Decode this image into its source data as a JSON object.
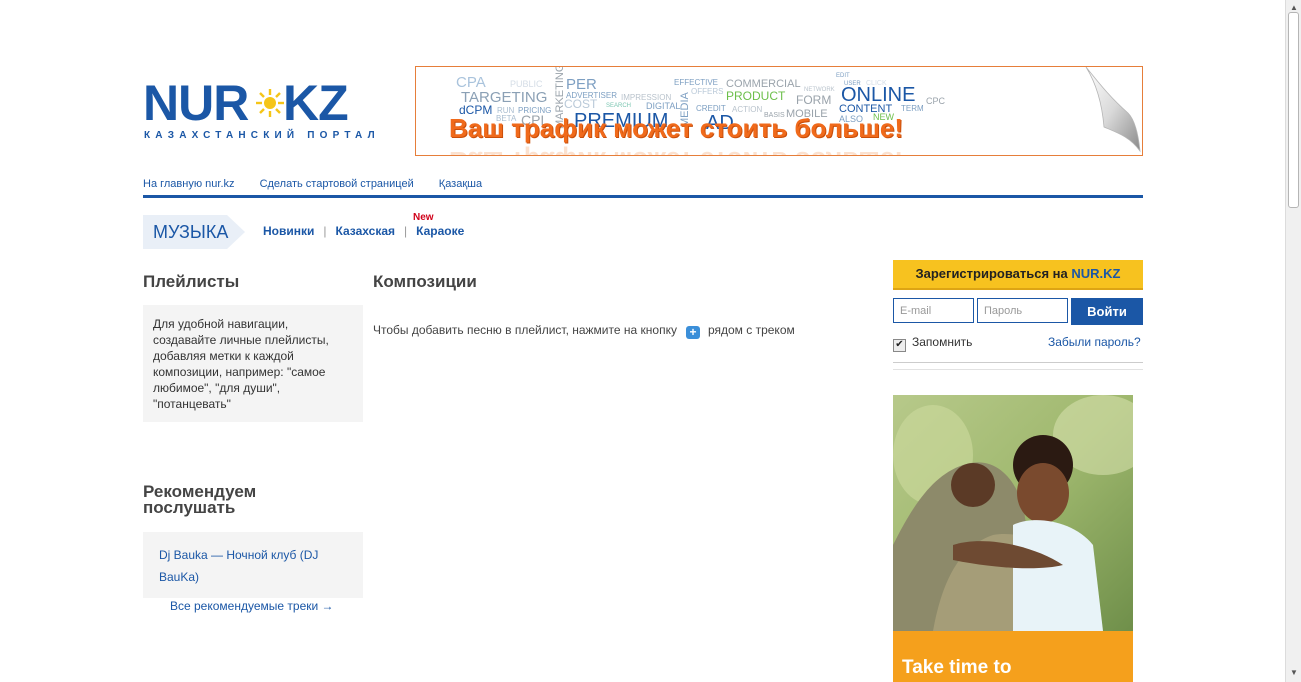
{
  "logo": {
    "word1": "NUR",
    "word2": "KZ",
    "tagline": "КАЗАХСТАНСКИЙ ПОРТАЛ"
  },
  "banner": {
    "headline": "Ваш трафик может стоить больше!",
    "cloud_words": [
      "CPA",
      "PUBLIC",
      "PER",
      "TARGETING",
      "ADVERTISER",
      "dCPM",
      "COST",
      "PRICING",
      "IMPRESSION",
      "PREMIUM",
      "DIGITAL",
      "MEDIA",
      "CREDIT",
      "EFFECTIVE",
      "OFFERS",
      "COMMERCIAL",
      "PRODUCT",
      "FORM",
      "MOBILE",
      "ONLINE",
      "CONTENT",
      "CPC",
      "TERM",
      "NEW",
      "ALSO",
      "BASIS",
      "ACTION",
      "USER",
      "CLICK",
      "EDIT",
      "NETWORK",
      "MARKETING",
      "RUN",
      "BETA",
      "CPL",
      "AD"
    ],
    "colors": {
      "headline": "#f06a1b",
      "border": "#e67e3a"
    }
  },
  "topnav": {
    "items": [
      "На главную nur.kz",
      "Сделать стартовой страницей",
      "Қазақша"
    ]
  },
  "section": {
    "title": "МУЗЫКА"
  },
  "subnav": {
    "items": [
      "Новинки",
      "Казахская",
      "Караоке"
    ],
    "new_badge": "New"
  },
  "playlists": {
    "heading": "Плейлисты",
    "info": "Для удобной навигации, создавайте личные плейлисты, добавляя метки к каждой композиции, например: \"самое любимое\", \"для души\", \"потанцевать\""
  },
  "recommend": {
    "heading": "Рекомендуем послушать",
    "track": "Dj Bauka — Ночной клуб (DJ BauKa)",
    "all_link": "Все рекомендуемые треки →"
  },
  "compositions": {
    "heading": "Композиции",
    "hint_before": "Чтобы добавить песню в плейлист, нажмите на кнопку",
    "hint_after": "рядом с треком",
    "plus_icon": "plus-icon"
  },
  "auth": {
    "register_prefix": "Зарегистрироваться на",
    "register_brand": "NUR.KZ",
    "email_placeholder": "E-mail",
    "password_placeholder": "Пароль",
    "login_label": "Войти",
    "remember_label": "Запомнить",
    "remember_checked": true,
    "forgot_label": "Забыли пароль?"
  },
  "ad2": {
    "text": "Take time to"
  },
  "colors": {
    "brand_blue": "#1b57a6",
    "register_yellow": "#f7c21f",
    "ad_orange": "#f5a01c"
  }
}
